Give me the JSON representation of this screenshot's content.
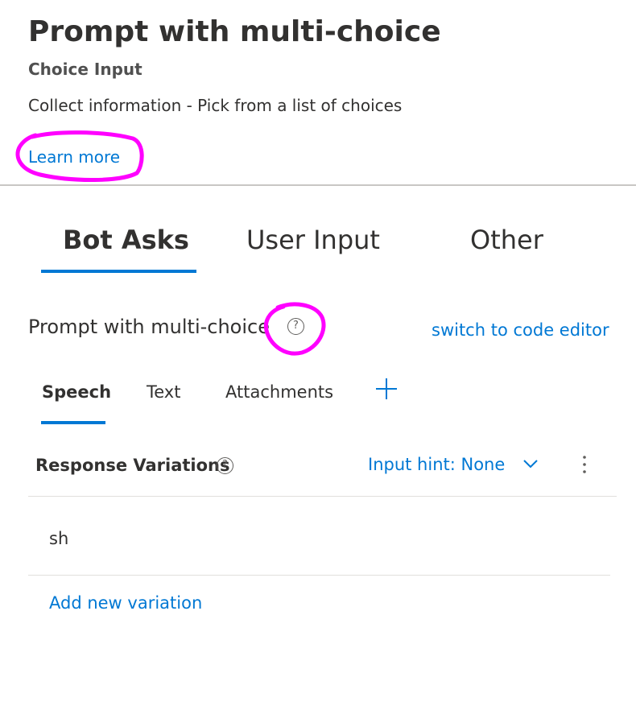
{
  "header": {
    "title": "Prompt with multi-choice",
    "subtitle": "Choice Input",
    "description": "Collect information - Pick from a list of choices",
    "learn_more": "Learn more"
  },
  "main_tabs": [
    {
      "label": "Bot Asks",
      "active": true
    },
    {
      "label": "User Input",
      "active": false
    },
    {
      "label": "Other",
      "active": false
    }
  ],
  "section": {
    "title": "Prompt with multi-choice",
    "help_glyph": "?",
    "switch_link": "switch to code editor"
  },
  "sub_tabs": [
    {
      "label": "Speech",
      "active": true
    },
    {
      "label": "Text",
      "active": false
    },
    {
      "label": "Attachments",
      "active": false
    }
  ],
  "icons": {
    "add_tab": "plus-icon",
    "help": "help-circle-icon",
    "dropdown": "chevron-down-icon",
    "more": "more-vertical-icon"
  },
  "response_variations": {
    "label": "Response Variations",
    "help_glyph": "?",
    "input_hint": "Input hint: None",
    "items": [
      "sh"
    ],
    "add_label": "Add new variation"
  },
  "colors": {
    "accent": "#0078d4",
    "annotation": "#ff00ff",
    "text": "#323130"
  }
}
